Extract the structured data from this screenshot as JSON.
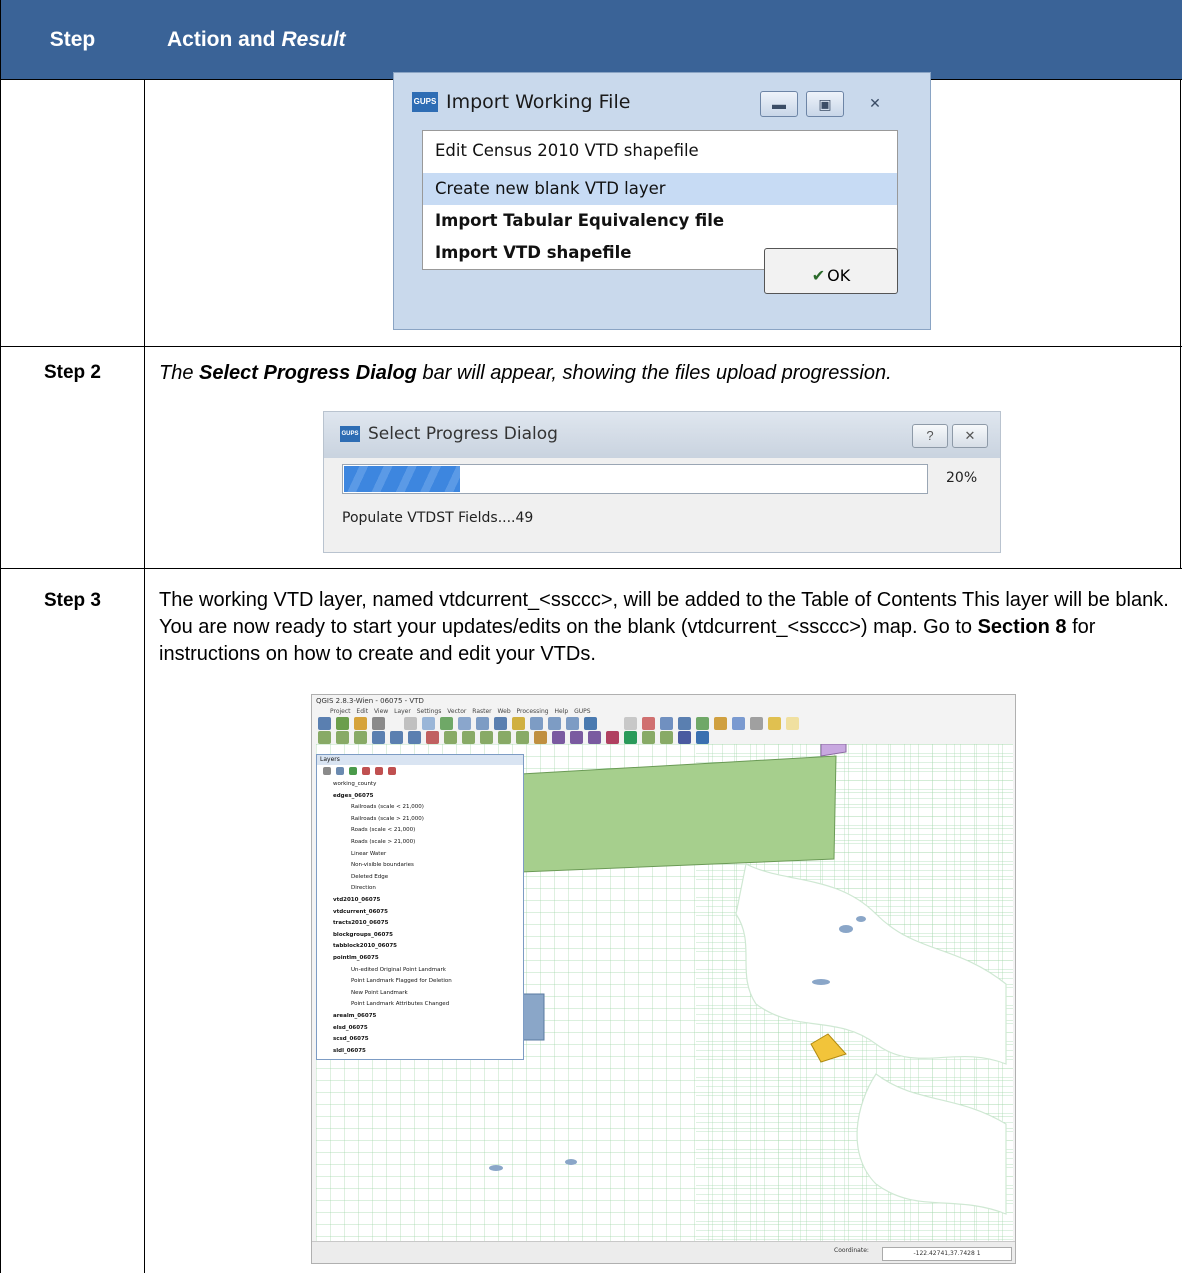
{
  "header": {
    "step_label": "Step",
    "action_label": "Action and",
    "result_label": "Result"
  },
  "rows": [
    {
      "step": "",
      "import_dialog": {
        "title": "Import Working File",
        "logo_text": "GUPS",
        "options": [
          "Edit Census 2010 VTD shapefile",
          "Create new blank VTD layer",
          "Import Tabular Equivalency file",
          "Import VTD shapefile"
        ],
        "selected_option": "Create new blank VTD layer",
        "ok_label": "OK"
      }
    },
    {
      "step": "Step 2",
      "text_pre": "The ",
      "text_bold": "Select Progress Dialog",
      "text_post": " bar will appear, showing the files upload progression.",
      "progress_dialog": {
        "title": "Select Progress Dialog",
        "logo_text": "GUPS",
        "percent_label": "20%",
        "progress": 0.2,
        "status": "Populate VTDST Fields....49"
      }
    },
    {
      "step": "Step 3",
      "text_pre": "The working VTD layer, named vtdcurrent_<ssccc>, will be added to the Table of Contents This layer will be blank. You are now ready to start your updates/edits on the blank (vtdcurrent_<ssccc>) map. Go to ",
      "text_bold": "Section 8",
      "text_post": " for instructions on how to create and edit your VTDs.",
      "qgis": {
        "window_title": "QGIS 2.8.3-Wien - 06075 - VTD",
        "menu": "Project Edit View Layer Settings Vector Raster Web Processing Help GUPS",
        "layers_title": "Layers",
        "layers": [
          "working_county",
          "edges_06075",
          "Railroads (scale < 21,000)",
          "Railroads (scale > 21,000)",
          "Roads (scale < 21,000)",
          "Roads (scale > 21,000)",
          "Linear Water",
          "Non-visible boundaries",
          "Deleted Edge",
          "Direction",
          "vtd2010_06075",
          "vtdcurrent_06075",
          "tracts2010_06075",
          "blockgroups_06075",
          "tabblock2010_06075",
          "pointlm_06075",
          "Un-edited Original Point Landmark",
          "Point Landmark Flagged for Deletion",
          "New Point Landmark",
          "Point Landmark Attributes Changed",
          "arealm_06075",
          "elsd_06075",
          "scsd_06075",
          "sldl_06075"
        ],
        "coordinate_label": "Coordinate:",
        "coordinate_value": "-122.42741,37.7428 1"
      }
    }
  ],
  "colors": {
    "header_bg": "#3a6397",
    "selection": "#c7dbf4",
    "progress": "#3d86df",
    "map_lines": "#8fd19e",
    "park": "#9cc985"
  }
}
